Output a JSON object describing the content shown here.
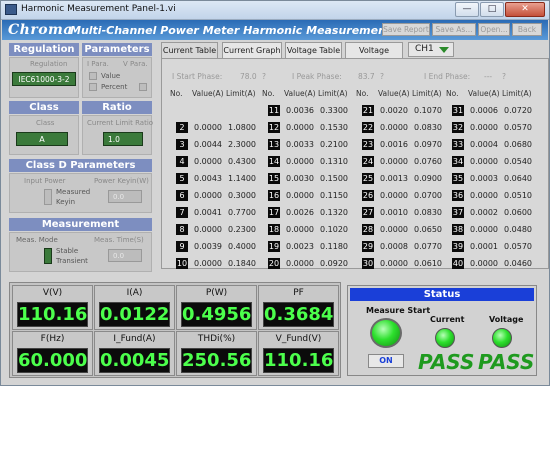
{
  "window": {
    "title": "Harmonic Measurement Panel-1.vi"
  },
  "header": {
    "logo": "Chroma",
    "title": "Multi-Channel Power Meter Harmonic Measurement",
    "buttons": [
      "Save Report",
      "Save As...",
      "Open...",
      "Back"
    ]
  },
  "regulation": {
    "header": "Regulation",
    "label": "Regulation",
    "value": "IEC61000-3-2"
  },
  "parameters": {
    "header": "Parameters",
    "i_para": "I Para.",
    "v_para": "V Para.",
    "value_label": "Value",
    "percent_label": "Percent"
  },
  "class": {
    "header": "Class",
    "label": "Class",
    "value": "A"
  },
  "ratio": {
    "header": "Ratio",
    "label": "Current Limit Ratio",
    "value": "1.0"
  },
  "class_d": {
    "header": "Class D Parameters",
    "input_power": "Input Power",
    "power_keyin": "Power Keyin(W)",
    "measured": "Measured",
    "keyin": "Keyin",
    "power_value": "0.0"
  },
  "measurement": {
    "header": "Measurement",
    "mode_label": "Meas. Mode",
    "time_label": "Meas. Time(S)",
    "stable": "Stable",
    "transient": "Transient",
    "time_value": "0.0"
  },
  "tabs": [
    "Current Table",
    "Current Graph",
    "Voltage Table",
    "Voltage Graph"
  ],
  "channel": "CH1",
  "phase": {
    "start_label": "I Start Phase:",
    "start_value": "78.0",
    "start_unit": "?",
    "peak_label": "I Peak Phase:",
    "peak_value": "83.7",
    "peak_unit": "?",
    "end_label": "I End Phase:",
    "end_value": "---",
    "end_unit": "?"
  },
  "table_headers": {
    "no": "No.",
    "value": "Value(A)",
    "limit": "Limit(A)"
  },
  "harmonics": [
    {
      "no": "2",
      "value": "0.0000",
      "limit": "1.0800"
    },
    {
      "no": "3",
      "value": "0.0044",
      "limit": "2.3000"
    },
    {
      "no": "4",
      "value": "0.0000",
      "limit": "0.4300"
    },
    {
      "no": "5",
      "value": "0.0043",
      "limit": "1.1400"
    },
    {
      "no": "6",
      "value": "0.0000",
      "limit": "0.3000"
    },
    {
      "no": "7",
      "value": "0.0041",
      "limit": "0.7700"
    },
    {
      "no": "8",
      "value": "0.0000",
      "limit": "0.2300"
    },
    {
      "no": "9",
      "value": "0.0039",
      "limit": "0.4000"
    },
    {
      "no": "10",
      "value": "0.0000",
      "limit": "0.1840"
    },
    {
      "no": "11",
      "value": "0.0036",
      "limit": "0.3300"
    },
    {
      "no": "12",
      "value": "0.0000",
      "limit": "0.1530"
    },
    {
      "no": "13",
      "value": "0.0033",
      "limit": "0.2100"
    },
    {
      "no": "14",
      "value": "0.0000",
      "limit": "0.1310"
    },
    {
      "no": "15",
      "value": "0.0030",
      "limit": "0.1500"
    },
    {
      "no": "16",
      "value": "0.0000",
      "limit": "0.1150"
    },
    {
      "no": "17",
      "value": "0.0026",
      "limit": "0.1320"
    },
    {
      "no": "18",
      "value": "0.0000",
      "limit": "0.1020"
    },
    {
      "no": "19",
      "value": "0.0023",
      "limit": "0.1180"
    },
    {
      "no": "20",
      "value": "0.0000",
      "limit": "0.0920"
    },
    {
      "no": "21",
      "value": "0.0020",
      "limit": "0.1070"
    },
    {
      "no": "22",
      "value": "0.0000",
      "limit": "0.0830"
    },
    {
      "no": "23",
      "value": "0.0016",
      "limit": "0.0970"
    },
    {
      "no": "24",
      "value": "0.0000",
      "limit": "0.0760"
    },
    {
      "no": "25",
      "value": "0.0013",
      "limit": "0.0900"
    },
    {
      "no": "26",
      "value": "0.0000",
      "limit": "0.0700"
    },
    {
      "no": "27",
      "value": "0.0010",
      "limit": "0.0830"
    },
    {
      "no": "28",
      "value": "0.0000",
      "limit": "0.0650"
    },
    {
      "no": "29",
      "value": "0.0008",
      "limit": "0.0770"
    },
    {
      "no": "30",
      "value": "0.0000",
      "limit": "0.0610"
    },
    {
      "no": "31",
      "value": "0.0006",
      "limit": "0.0720"
    },
    {
      "no": "32",
      "value": "0.0000",
      "limit": "0.0570"
    },
    {
      "no": "33",
      "value": "0.0004",
      "limit": "0.0680"
    },
    {
      "no": "34",
      "value": "0.0000",
      "limit": "0.0540"
    },
    {
      "no": "35",
      "value": "0.0003",
      "limit": "0.0640"
    },
    {
      "no": "36",
      "value": "0.0000",
      "limit": "0.0510"
    },
    {
      "no": "37",
      "value": "0.0002",
      "limit": "0.0600"
    },
    {
      "no": "38",
      "value": "0.0000",
      "limit": "0.0480"
    },
    {
      "no": "39",
      "value": "0.0001",
      "limit": "0.0570"
    },
    {
      "no": "40",
      "value": "0.0000",
      "limit": "0.0460"
    }
  ],
  "meters": [
    {
      "label": "V(V)",
      "value": "110.16"
    },
    {
      "label": "I(A)",
      "value": "0.0122"
    },
    {
      "label": "P(W)",
      "value": "0.4956"
    },
    {
      "label": "PF",
      "value": "0.3684"
    },
    {
      "label": "F(Hz)",
      "value": "60.000"
    },
    {
      "label": "I_Fund(A)",
      "value": "0.0045"
    },
    {
      "label": "THDi(%)",
      "value": "250.56"
    },
    {
      "label": "V_Fund(V)",
      "value": "110.16"
    }
  ],
  "status": {
    "header": "Status",
    "measure_start": "Measure Start",
    "on_label": "ON",
    "current_label": "Current",
    "voltage_label": "Voltage",
    "current_result": "PASS",
    "voltage_result": "PASS"
  },
  "colors": {
    "accent_blue": "#1a3fd8",
    "led_green": "#2de02d",
    "meter_digits": "#4cff4c",
    "panel_label": "#7d8ec0"
  }
}
